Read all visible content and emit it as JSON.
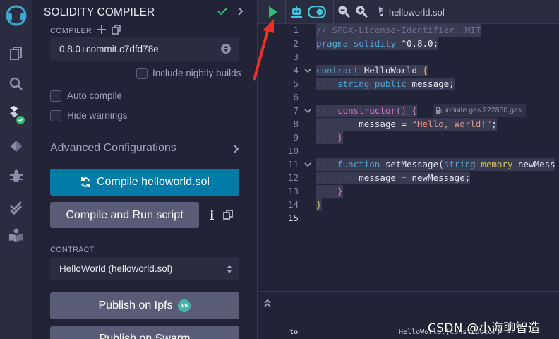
{
  "panel": {
    "title": "SOLIDITY COMPILER",
    "compiler_label": "COMPILER",
    "compiler_version": "0.8.0+commit.c7dfd78e",
    "include_nightly": "Include nightly builds",
    "auto_compile": "Auto compile",
    "hide_warnings": "Hide warnings",
    "advanced": "Advanced Configurations",
    "compile_button": "Compile helloworld.sol",
    "compile_run_button": "Compile and Run script",
    "contract_label": "CONTRACT",
    "contract_selected": "HelloWorld (helloworld.sol)",
    "publish_ipfs": "Publish on Ipfs",
    "ipfs_badge": "ipfs",
    "publish_swarm": "Publish on Swarm"
  },
  "editor": {
    "tab_name": "helloworld.sol",
    "line_numbers": [
      "1",
      "2",
      "3",
      "4",
      "5",
      "6",
      "7",
      "8",
      "9",
      "10",
      "11",
      "12",
      "13",
      "14",
      "15"
    ],
    "gas_annotation": "infinite gas 222800 gas",
    "code": {
      "l1": "// SPDX-License-Identifier: MIT",
      "l2_kw": "pragma solidity",
      "l2_rest": " ^0.8.0;",
      "l4_kw": "contract",
      "l4_name": " HelloWorld ",
      "l4_brace": "{",
      "l5_ind": "····",
      "l5_t1": "string",
      "l5_t2": " public",
      "l5_t3": " message;",
      "l7_ind": "····",
      "l7_t1": "constructor",
      "l7_t2": "() {",
      "l8_ind": "········",
      "l8_t1": "message = ",
      "l8_t2": "\"Hello, World!\"",
      "l8_t3": ";",
      "l9_ind": "····",
      "l9_t1": "}",
      "l11_ind": "····",
      "l11_t1": "function",
      "l11_t2": " setMessage(",
      "l11_t3": "string",
      "l11_t4": " memory",
      "l11_t5": " newMess",
      "l12_ind": "········",
      "l12_t1": "message = newMessage;",
      "l13_ind": "····",
      "l13_t1": "}",
      "l14_t1": "}"
    }
  },
  "terminal": {
    "to_label": "to",
    "fn_text": "HelloWorld.(constructor)"
  },
  "watermark": "CSDN @小海聊智造",
  "colors": {
    "accent_blue": "#007aa6",
    "success_green": "#2fbf71",
    "annotation_red": "#e8312a",
    "run_green": "#2fbf71",
    "cyan": "#3fc6e0"
  }
}
